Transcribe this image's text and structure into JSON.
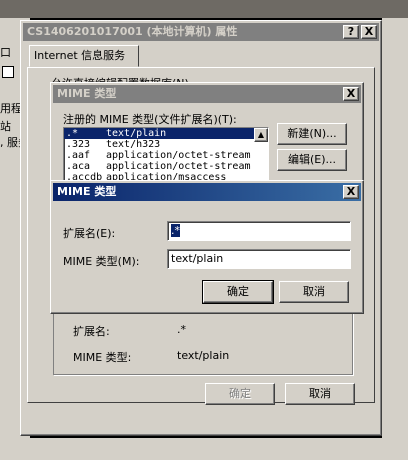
{
  "bg_window": {
    "left_fragments": [
      "口",
      "用程/",
      "站",
      ", 服务"
    ]
  },
  "props_window": {
    "title": "CS1406201017001 (本地计算机) 属性",
    "help_btn": "?",
    "close_btn": "X",
    "tab": "Internet 信息服务",
    "hidden_checkbox_label": "允许直接编辑配置数据库(N)",
    "ext_label": "扩展名:",
    "ext_value": ".*",
    "mime_label": "MIME 类型:",
    "mime_value": "text/plain",
    "ok": "确定",
    "cancel": "取消"
  },
  "mime_types_dialog": {
    "title": "MIME 类型",
    "close_btn": "X",
    "list_label": "注册的 MIME 类型(文件扩展名)(T):",
    "new_btn": "新建(N)...",
    "edit_btn": "编辑(E)...",
    "rows": [
      {
        "ext": ".*",
        "type": "text/plain",
        "selected": true
      },
      {
        "ext": ".323",
        "type": "text/h323",
        "selected": false
      },
      {
        "ext": ".aaf",
        "type": "application/octet-stream",
        "selected": false
      },
      {
        "ext": ".aca",
        "type": "application/octet-stream",
        "selected": false
      },
      {
        "ext": ".accdb",
        "type": "application/msaccess",
        "selected": false
      }
    ]
  },
  "mime_edit_dialog": {
    "title": "MIME 类型",
    "close_btn": "X",
    "ext_label": "扩展名(E):",
    "ext_value": ".*",
    "mime_label": "MIME 类型(M):",
    "mime_value": "text/plain",
    "ok": "确定",
    "cancel": "取消"
  },
  "colors": {
    "active_title": "#0a246a",
    "inactive_title": "#808080",
    "face": "#d4d0c8"
  }
}
